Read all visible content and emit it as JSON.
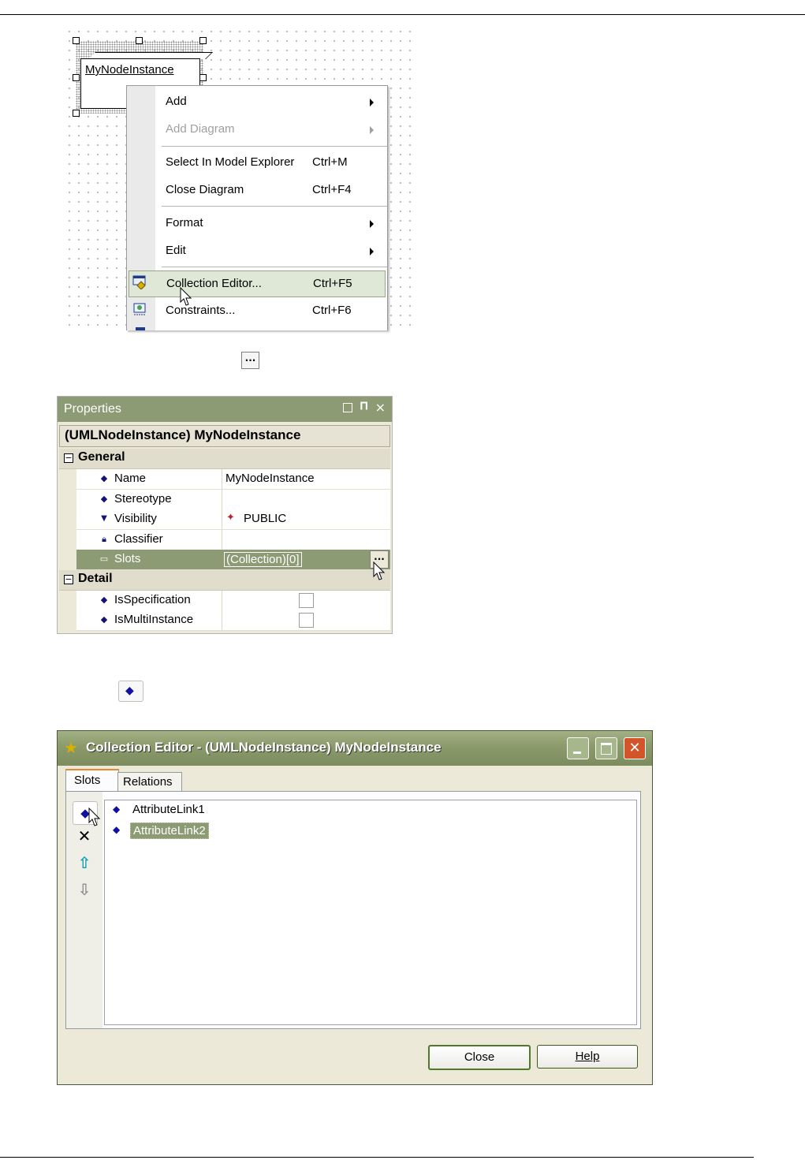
{
  "diagram": {
    "node_label": "MyNodeInstance"
  },
  "context_menu": {
    "items": [
      {
        "label": "Add",
        "shortcut": "",
        "submenu": true,
        "disabled": false
      },
      {
        "label": "Add Diagram",
        "shortcut": "",
        "submenu": true,
        "disabled": true
      },
      {
        "label": "Select In Model Explorer",
        "shortcut": "Ctrl+M",
        "submenu": false,
        "disabled": false
      },
      {
        "label": "Close Diagram",
        "shortcut": "Ctrl+F4",
        "submenu": false,
        "disabled": false
      },
      {
        "label": "Format",
        "shortcut": "",
        "submenu": true,
        "disabled": false
      },
      {
        "label": "Edit",
        "shortcut": "",
        "submenu": true,
        "disabled": false
      },
      {
        "label": "Collection Editor...",
        "shortcut": "Ctrl+F5",
        "submenu": false,
        "disabled": false,
        "highlighted": true
      },
      {
        "label": "Constraints...",
        "shortcut": "Ctrl+F6",
        "submenu": false,
        "disabled": false
      }
    ]
  },
  "ellipsis_glyph": "...",
  "properties": {
    "title": "Properties",
    "header": "(UMLNodeInstance) MyNodeInstance",
    "categories": [
      {
        "name": "General",
        "rows": [
          {
            "label": "Name",
            "value": "MyNodeInstance"
          },
          {
            "label": "Stereotype",
            "value": ""
          },
          {
            "label": "Visibility",
            "value": "PUBLIC"
          },
          {
            "label": "Classifier",
            "value": ""
          },
          {
            "label": "Slots",
            "value": "(Collection)[0]"
          }
        ]
      },
      {
        "name": "Detail",
        "rows": [
          {
            "label": "IsSpecification",
            "value": ""
          },
          {
            "label": "IsMultiInstance",
            "value": ""
          }
        ]
      }
    ],
    "browse_button_label": "..."
  },
  "collection_editor": {
    "title": "Collection Editor - (UMLNodeInstance) MyNodeInstance",
    "tabs": [
      "Slots",
      "Relations"
    ],
    "active_tab": "Slots",
    "items": [
      "AttributeLink1",
      "AttributeLink2"
    ],
    "selected_item": "AttributeLink2",
    "buttons": {
      "close": "Close",
      "help": "Help"
    }
  },
  "colors": {
    "theme_olive": "#8c9b74",
    "selection_green": "#8c9b74",
    "close_red": "#d4542a",
    "diamond_blue": "#1010a0"
  }
}
